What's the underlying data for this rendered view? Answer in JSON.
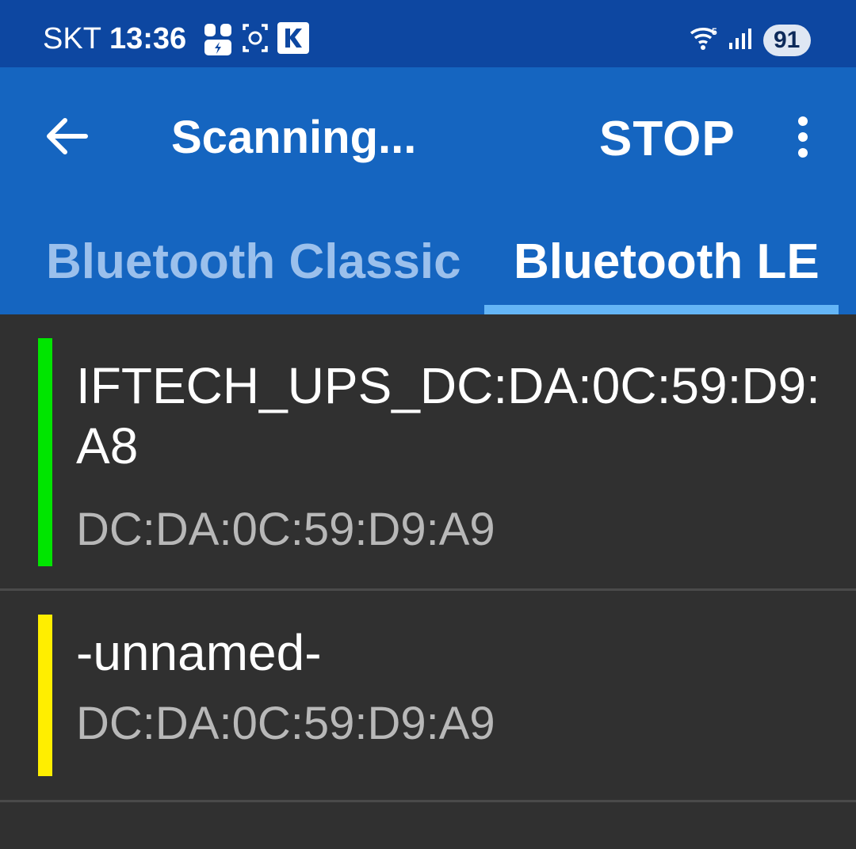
{
  "status_bar": {
    "carrier": "SKT",
    "time": "13:36",
    "battery": "91",
    "icons": [
      "earbuds-charging-icon",
      "screenshot-icon",
      "k-app-icon",
      "wifi-icon",
      "signal-icon",
      "battery-icon"
    ]
  },
  "app_bar": {
    "back_icon": "arrow-back-icon",
    "title": "Scanning...",
    "stop_label": "STOP",
    "more_icon": "more-vert-icon"
  },
  "tabs": [
    {
      "label": "Bluetooth Classic",
      "selected": false
    },
    {
      "label": "Bluetooth LE",
      "selected": true
    }
  ],
  "devices": [
    {
      "name": "IFTECH_UPS_DC:DA:0C:59:D9:A8",
      "address": "DC:DA:0C:59:D9:A9",
      "signal_color": "#00e500"
    },
    {
      "name": "-unnamed-",
      "address": "DC:DA:0C:59:D9:A9",
      "signal_color": "#ffee00"
    }
  ],
  "colors": {
    "status_bar": "#0d47a1",
    "primary": "#1565c0",
    "tab_indicator": "#64b5f6",
    "background": "#303030"
  }
}
